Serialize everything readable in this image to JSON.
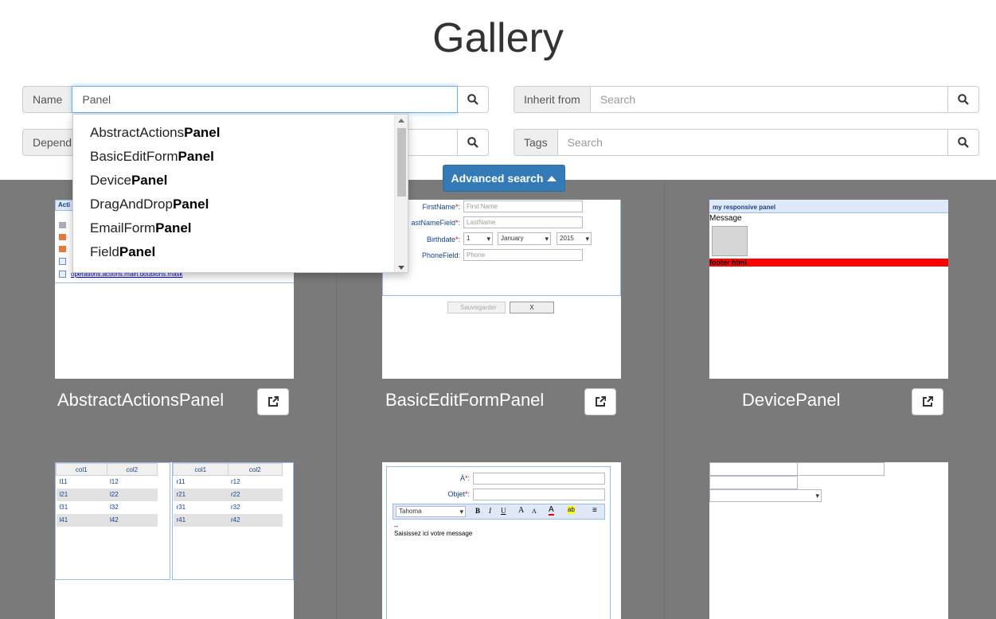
{
  "title": "Gallery",
  "filters": {
    "name": {
      "label": "Name",
      "value": "Panel"
    },
    "inherit": {
      "label": "Inherit from",
      "placeholder": "Search"
    },
    "depends": {
      "label": "Depend",
      "placeholder": "Search"
    },
    "tags": {
      "label": "Tags",
      "placeholder": "Search"
    }
  },
  "advanced_search": {
    "label": "Advanced search",
    "icon": "caret-up-icon"
  },
  "autocomplete": [
    {
      "prefix": "AbstractActions",
      "match": "Panel"
    },
    {
      "prefix": "BasicEditForm",
      "match": "Panel"
    },
    {
      "prefix": "Device",
      "match": "Panel"
    },
    {
      "prefix": "DragAndDrop",
      "match": "Panel"
    },
    {
      "prefix": "EmailForm",
      "match": "Panel"
    },
    {
      "prefix": "Field",
      "match": "Panel"
    }
  ],
  "cards": [
    {
      "title": "AbstractActionsPanel",
      "preview": {
        "header": "Acti",
        "link": "operations.actions.main.doublons.mask"
      }
    },
    {
      "title": "BasicEditFormPanel",
      "preview": {
        "fields": [
          {
            "label": "FirstName",
            "placeholder": "First Name",
            "required": true
          },
          {
            "label": "astNameField",
            "placeholder": "LastName",
            "required": true
          },
          {
            "label": "PhoneField",
            "placeholder": "Phone",
            "required": false
          }
        ],
        "birthdate": {
          "label": "Birthdate",
          "day": "1",
          "month": "January",
          "year": "2015"
        },
        "save": "Sauvegarder",
        "cancel": "X"
      }
    },
    {
      "title": "DevicePanel",
      "preview": {
        "header": "my responsive panel",
        "message": "Message",
        "footer": "footer html"
      }
    },
    {
      "title": "",
      "preview": {
        "left": {
          "columns": [
            "col1",
            "col2"
          ],
          "rows": [
            [
              "l11",
              "l12"
            ],
            [
              "l21",
              "l22"
            ],
            [
              "l31",
              "l32"
            ],
            [
              "l41",
              "l42"
            ]
          ]
        },
        "right": {
          "columns": [
            "col1",
            "col2"
          ],
          "rows": [
            [
              "r11",
              "r12"
            ],
            [
              "r21",
              "r22"
            ],
            [
              "r31",
              "r32"
            ],
            [
              "r41",
              "r42"
            ]
          ]
        }
      }
    },
    {
      "title": "",
      "preview": {
        "to_label": "À",
        "subject_label": "Objet",
        "font": "Tahoma",
        "body_separator": "--",
        "body": "Saisissez ici votre message"
      }
    },
    {
      "title": "",
      "preview": {}
    }
  ],
  "colors": {
    "accent": "#337ab7",
    "gallery_bg": "#7a7a7a",
    "focus": "#66afe9"
  }
}
